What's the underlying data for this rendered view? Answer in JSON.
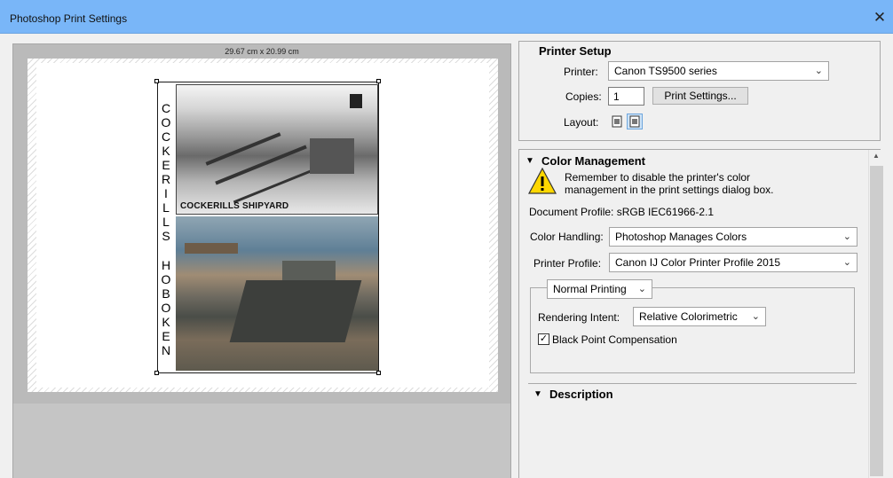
{
  "window": {
    "title": "Photoshop Print Settings",
    "close_glyph": "✕"
  },
  "preview": {
    "dimensions": "29.67 cm x 20.99 cm",
    "vertical_text": [
      "C",
      "O",
      "C",
      "K",
      "E",
      "R",
      "I",
      "L",
      "L",
      "S",
      "",
      "H",
      "O",
      "B",
      "O",
      "K",
      "E",
      "N"
    ],
    "photo_caption": "COCKERILLS SHIPYARD"
  },
  "printer_setup": {
    "heading": "Printer Setup",
    "printer_label": "Printer:",
    "printer_value": "Canon TS9500 series",
    "copies_label": "Copies:",
    "copies_value": "1",
    "print_settings_button": "Print Settings...",
    "layout_label": "Layout:"
  },
  "color_management": {
    "heading": "Color Management",
    "warning": "Remember to disable the printer's color management in the print settings dialog box.",
    "document_profile": "Document Profile: sRGB IEC61966-2.1",
    "color_handling_label": "Color Handling:",
    "color_handling_value": "Photoshop Manages Colors",
    "printer_profile_label": "Printer Profile:",
    "printer_profile_value": "Canon IJ Color Printer Profile 2015",
    "printing_mode_value": "Normal Printing",
    "rendering_intent_label": "Rendering Intent:",
    "rendering_intent_value": "Relative Colorimetric",
    "black_point_label": "Black Point Compensation",
    "black_point_checked": true
  },
  "description": {
    "heading": "Description"
  },
  "icons": {
    "chevron": "chevron-down-icon",
    "collapse": "triangle-down-icon",
    "warning": "warning-icon"
  }
}
